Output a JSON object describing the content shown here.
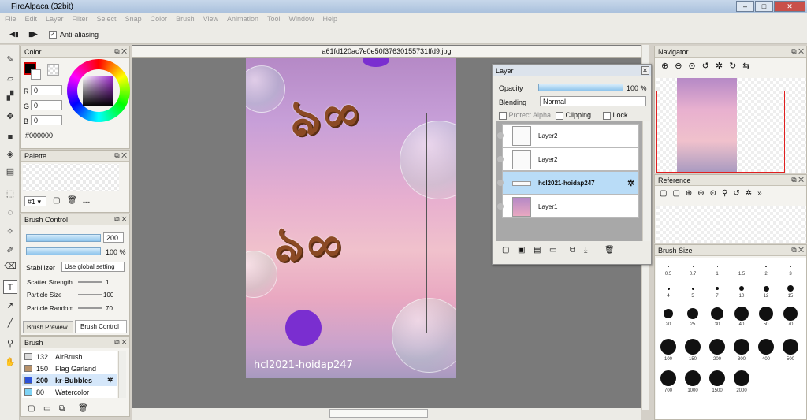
{
  "app": {
    "title": "FireAlpaca (32bit)",
    "window_buttons": [
      "–",
      "□",
      "✕"
    ]
  },
  "menu": [
    "File",
    "Edit",
    "Layer",
    "Filter",
    "Select",
    "Snap",
    "Color",
    "Brush",
    "View",
    "Animation",
    "Tool",
    "Window",
    "Help"
  ],
  "toolbar": {
    "antialias_label": "Anti-aliasing",
    "antialias_checked": "✓"
  },
  "color_panel": {
    "title": "Color",
    "r_label": "R",
    "r": "0",
    "g_label": "G",
    "g": "0",
    "b_label": "B",
    "b": "0",
    "hex": "#000000"
  },
  "palette_panel": {
    "title": "Palette",
    "selector": "#1 ▾",
    "dash": "---"
  },
  "brush_control": {
    "title": "Brush Control",
    "size": "200",
    "opacity": "100 %",
    "stabilizer_label": "Stabilizer",
    "stabilizer_value": "Use global setting",
    "scatter_label": "Scatter Strength",
    "scatter_value": "1",
    "particle_size_label": "Particle Size",
    "particle_size_value": "100",
    "particle_random_label": "Particle Random",
    "particle_random_value": "70",
    "tab_preview": "Brush Preview",
    "tab_control": "Brush Control"
  },
  "brush_panel": {
    "title": "Brush",
    "items": [
      {
        "size": "132",
        "name": "AirBrush",
        "color": "#dcdcdc"
      },
      {
        "size": "150",
        "name": "Flag Garland",
        "color": "#b8926a"
      },
      {
        "size": "200",
        "name": "kr-Bubbles",
        "color": "#2c52d8"
      },
      {
        "size": "80",
        "name": "Watercolor",
        "color": "#7fd3f5"
      }
    ]
  },
  "document": {
    "tab": "a61fd120ac7e0e50f37630155731ffd9.jpg",
    "watermark": "hcl2021-hoidap247"
  },
  "layer_panel": {
    "title": "Layer",
    "opacity_label": "Opacity",
    "opacity_value": "100 %",
    "blending_label": "Blending",
    "blending_value": "Normal",
    "protect_alpha": "Protect Alpha",
    "clipping": "Clipping",
    "lock": "Lock",
    "layers": [
      {
        "name": "Layer2"
      },
      {
        "name": "Layer2"
      },
      {
        "name": "hcl2021-hoidap247"
      },
      {
        "name": "Layer1"
      }
    ]
  },
  "navigator": {
    "title": "Navigator"
  },
  "reference": {
    "title": "Reference"
  },
  "brush_size": {
    "title": "Brush Size",
    "sizes": [
      "0.5",
      "0.7",
      "1",
      "1.5",
      "2",
      "3",
      "4",
      "5",
      "7",
      "10",
      "12",
      "15",
      "20",
      "25",
      "30",
      "40",
      "50",
      "70",
      "100",
      "150",
      "200",
      "300",
      "400",
      "500",
      "700",
      "1000",
      "1500",
      "2000"
    ]
  },
  "colors": {
    "accent": "#8fc5ec",
    "selected_layer": "#b9dcf7"
  }
}
